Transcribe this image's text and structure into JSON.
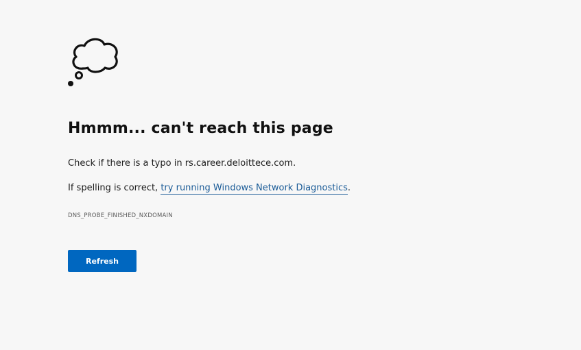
{
  "icon": "thought-cloud-icon",
  "title": "Hmmm... can't reach this page",
  "line1": {
    "prefix": "Check if there is a typo in ",
    "domain": "rs.career.deloittece.com",
    "suffix": "."
  },
  "line2": {
    "prefix": "If spelling is correct, ",
    "link_text": "try running Windows Network Diagnostics",
    "suffix": "."
  },
  "error_code": "DNS_PROBE_FINISHED_NXDOMAIN",
  "refresh_label": "Refresh",
  "colors": {
    "background": "#f7f7f7",
    "link": "#1a5b97",
    "button": "#0067c0"
  }
}
